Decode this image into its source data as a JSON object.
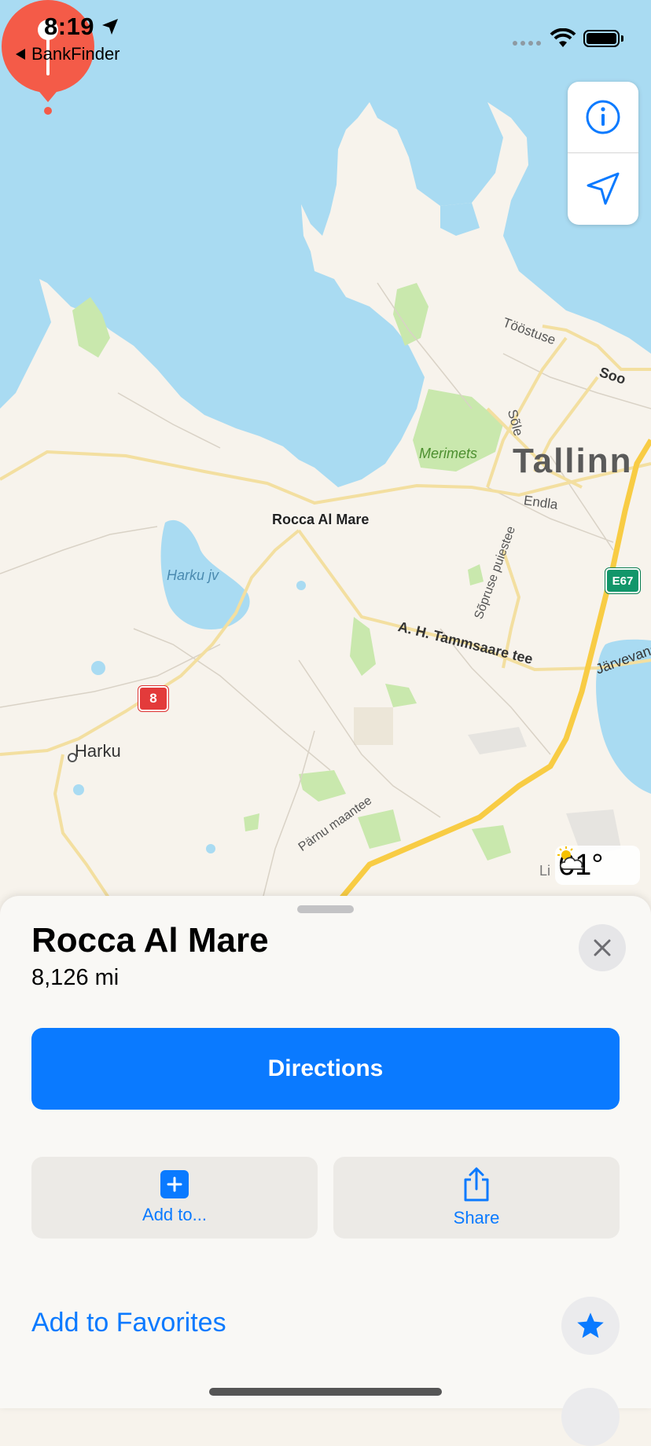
{
  "status_bar": {
    "time": "8:19",
    "back_label": "BankFinder"
  },
  "map": {
    "pin_label": "Rocca Al Mare",
    "labels": {
      "city": "Tallinn",
      "lake": "Harku jv",
      "park": "Merimets",
      "village": "Harku",
      "road_toostuse": "Tööstuse",
      "road_soo": "Soo",
      "road_sole": "Sõle",
      "road_endla": "Endla",
      "road_sopruse": "Sõpruse puiestee",
      "road_tammsaare": "A. H. Tammsaare tee",
      "road_parnu": "Pärnu maantee",
      "road_jarvevana": "Järvevana",
      "shield_route": "8",
      "shield_e67": "E67",
      "edge_text": "Li"
    },
    "weather_temp": "61°",
    "icons": [
      "info-icon",
      "location-arrow-icon",
      "map-pin-icon",
      "weather-partly-cloudy-icon"
    ],
    "colors": {
      "water": "#a9dbf2",
      "land": "#f7f3ec",
      "park": "#c9e8ad",
      "road_major": "#f8cc44",
      "road_minor": "#f6e6ae",
      "pin": "#f45b48"
    }
  },
  "sheet": {
    "title": "Rocca Al Mare",
    "distance": "8,126 mi",
    "directions_label": "Directions",
    "add_label": "Add to...",
    "share_label": "Share",
    "favorites_label": "Add to Favorites",
    "icons": [
      "close-icon",
      "add-icon",
      "share-icon",
      "star-icon"
    ],
    "colors": {
      "accent": "#0a7aff"
    }
  }
}
